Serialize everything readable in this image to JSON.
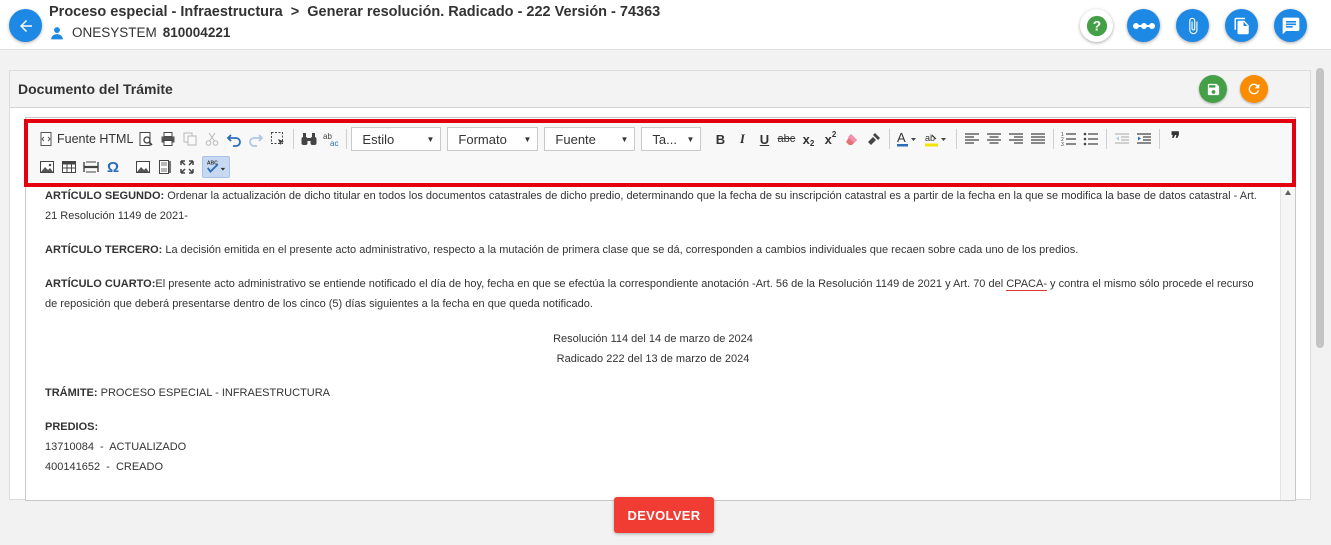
{
  "header": {
    "title": "Proceso especial - Infraestructura",
    "breadcrumb_sep": ">",
    "subtitle": "Generar resolución. Radicado - 222 Versión - 74363",
    "user_name": "ONESYSTEM",
    "user_nit": "810004221",
    "buttons": [
      {
        "icon": "help-icon"
      },
      {
        "icon": "more-icon"
      },
      {
        "icon": "attachment-icon"
      },
      {
        "icon": "documents-icon"
      },
      {
        "icon": "comments-icon"
      }
    ]
  },
  "panel": {
    "title": "Documento del Trámite",
    "save_icon": "save-icon",
    "refresh_icon": "refresh-icon"
  },
  "toolbar": {
    "source_label": "Fuente HTML",
    "combo_style": "Estilo",
    "combo_format": "Formato",
    "combo_font": "Fuente",
    "combo_size": "Ta...",
    "bold": "B",
    "italic": "I",
    "underline": "U",
    "strike": "abc",
    "subscript": "x",
    "subscript_sub": "2",
    "superscript": "x",
    "superscript_sup": "2",
    "omega": "Ω",
    "quote": "❞",
    "spell_label": "ABC"
  },
  "document": {
    "art2_label": "ARTÍCULO SEGUNDO:",
    "art2_text": " Ordenar la actualización de dicho titular en todos los documentos catastrales de dicho predio, determinando que la fecha de su inscripción catastral es a partir de la fecha en la que se modifica la base de datos catastral - Art. 21 Resolución 1149 de 2021-",
    "art3_label": "ARTÍCULO TERCERO:",
    "art3_text": " La decisión emitida en el presente acto administrativo, respecto a la mutación de primera clase que se dá, corresponden a cambios individuales que recaen sobre cada uno de los predios.",
    "art4_label": "ARTÍCULO CUARTO:",
    "art4_text_a": "El presente acto administrativo se entiende notificado el día de hoy, fecha en que se efectúa la correspondiente anotación -Art. 56 de la Resolución 1149 de 2021 y Art. 70 del ",
    "art4_spell": "CPACA-",
    "art4_text_b": " y contra el mismo sólo procede el recurso de reposición que deberá presentarse dentro de los cinco (5) días siguientes a la fecha en que queda notificado.",
    "resolution_line": "Resolución 114 del 14 de marzo de 2024",
    "radicado_line": "Radicado 222 del 13 de marzo de 2024",
    "tramite_label": "TRÁMITE:",
    "tramite_value": " PROCESO ESPECIAL - INFRAESTRUCTURA",
    "predios_label": "PREDIOS:",
    "predios": [
      "13710084  -  ACTUALIZADO",
      "400141652  -  CREADO"
    ]
  },
  "footer": {
    "return_label": "DEVOLVER"
  },
  "colors": {
    "primary": "#1e88e5",
    "save": "#43a047",
    "refresh": "#fb8c00",
    "danger": "#f03c32",
    "highlight": "#e3000f"
  }
}
